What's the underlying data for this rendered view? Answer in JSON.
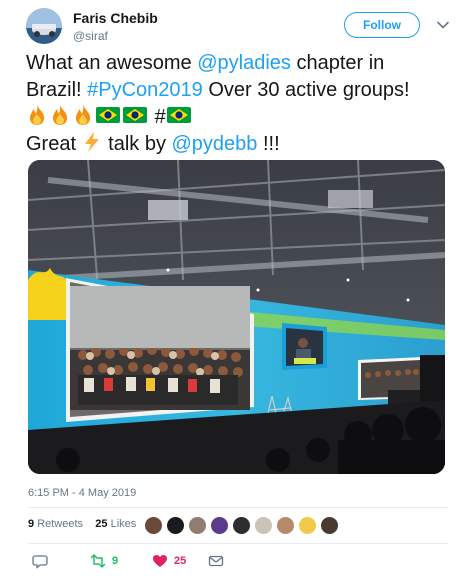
{
  "user": {
    "name": "Faris Chebib",
    "handle": "@siraf"
  },
  "follow_label": "Follow",
  "tweet": {
    "line1_a": "What an awesome ",
    "line1_link": "@pyladies",
    "line1_b": " chapter in",
    "line2_a": "Brazil! ",
    "line2_link": "#PyCon2019",
    "line2_b": " Over 30 active groups!",
    "line3_hash": "#",
    "line4_a": "Great ",
    "line4_b": " talk by ",
    "line4_link": "@pydebb",
    "line4_c": " !!!"
  },
  "timestamp": "6:15 PM - 4 May 2019",
  "stats": {
    "retweets_count": "9",
    "retweets_label": "Retweets",
    "likes_count": "25",
    "likes_label": "Likes"
  },
  "actions": {
    "retweet_count": "9",
    "like_count": "25"
  },
  "colors": {
    "link": "#1da1f2",
    "like": "#e0245e",
    "retweet": "#17bf63"
  }
}
